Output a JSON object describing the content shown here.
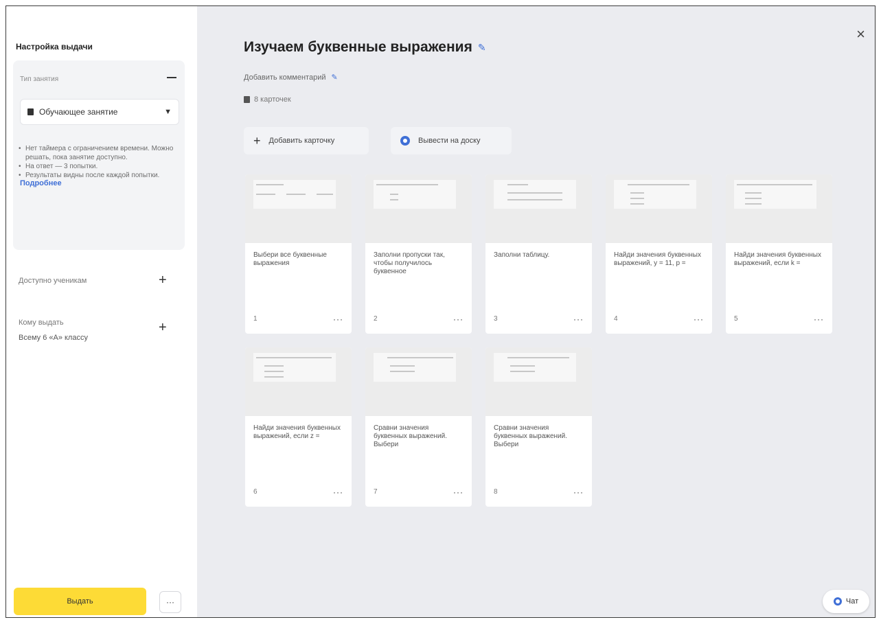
{
  "sidebar": {
    "title": "Настройка выдачи",
    "lesson_type_label": "Тип занятия",
    "lesson_type_value": "Обучающее занятие",
    "rules": [
      "Нет таймера с ограничением времени. Можно решать, пока занятие доступно.",
      "На ответ — 3 попытки.",
      "Результаты видны после каждой попытки."
    ],
    "more_link": "Подробнее",
    "available_label": "Доступно ученикам",
    "recipient_label": "Кому выдать",
    "recipient_value": "Всему 6 «А» классу",
    "issue_button": "Выдать",
    "more_button": "···"
  },
  "main": {
    "title": "Изучаем буквенные выражения",
    "comment_link": "Добавить комментарий",
    "card_count": "8 карточек",
    "add_card_button": "Добавить карточку",
    "board_button": "Вывести на доску",
    "close": "×",
    "chat_button": "Чат"
  },
  "cards": [
    {
      "text": "Выбери все буквенные выражения",
      "num": "1",
      "more": "···"
    },
    {
      "text": "Заполни пропуски так, чтобы получилось буквенное",
      "num": "2",
      "more": "···"
    },
    {
      "text": "Заполни таблицу.",
      "num": "3",
      "more": "···"
    },
    {
      "text": "Найди значения буквенных выражений, у = 11, р =",
      "num": "4",
      "more": "···"
    },
    {
      "text": "Найди значения буквенных выражений, если k =",
      "num": "5",
      "more": "···"
    },
    {
      "text": "Найди значения буквенных выражений, если z =",
      "num": "6",
      "more": "···"
    },
    {
      "text": "Сравни значения буквенных выражений. Выбери",
      "num": "7",
      "more": "···"
    },
    {
      "text": "Сравни значения буквенных выражений. Выбери",
      "num": "8",
      "more": "···"
    }
  ],
  "colors": {
    "accent_blue": "#3f6fd6",
    "issue_yellow": "#fddb36",
    "main_bg": "#ebecf0"
  }
}
